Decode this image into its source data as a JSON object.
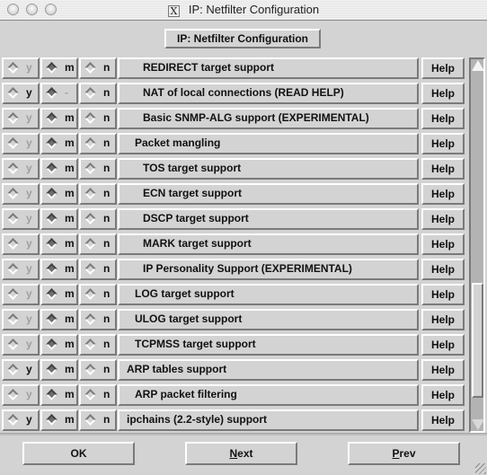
{
  "window": {
    "title": "IP: Netfilter Configuration",
    "title_icon": "x11-icon",
    "title_icon_glyph": "X"
  },
  "header": {
    "button_label": "IP: Netfilter Configuration"
  },
  "options": [
    {
      "label": "REDIRECT target support",
      "indent": 2,
      "y": {
        "label": "y",
        "enabled": false,
        "selected": false
      },
      "m": {
        "label": "m",
        "enabled": true,
        "selected": true
      },
      "n": {
        "label": "n",
        "enabled": true,
        "selected": false
      },
      "help": "Help"
    },
    {
      "label": "NAT of local connections (READ HELP)",
      "indent": 2,
      "y": {
        "label": "y",
        "enabled": true,
        "selected": false
      },
      "m": {
        "label": "-",
        "enabled": false,
        "selected": true
      },
      "n": {
        "label": "n",
        "enabled": true,
        "selected": false
      },
      "help": "Help"
    },
    {
      "label": "Basic SNMP-ALG support (EXPERIMENTAL)",
      "indent": 2,
      "y": {
        "label": "y",
        "enabled": false,
        "selected": false
      },
      "m": {
        "label": "m",
        "enabled": true,
        "selected": true
      },
      "n": {
        "label": "n",
        "enabled": true,
        "selected": false
      },
      "help": "Help"
    },
    {
      "label": "Packet mangling",
      "indent": 1,
      "y": {
        "label": "y",
        "enabled": false,
        "selected": false
      },
      "m": {
        "label": "m",
        "enabled": true,
        "selected": true
      },
      "n": {
        "label": "n",
        "enabled": true,
        "selected": false
      },
      "help": "Help"
    },
    {
      "label": "TOS target support",
      "indent": 2,
      "y": {
        "label": "y",
        "enabled": false,
        "selected": false
      },
      "m": {
        "label": "m",
        "enabled": true,
        "selected": true
      },
      "n": {
        "label": "n",
        "enabled": true,
        "selected": false
      },
      "help": "Help"
    },
    {
      "label": "ECN target support",
      "indent": 2,
      "y": {
        "label": "y",
        "enabled": false,
        "selected": false
      },
      "m": {
        "label": "m",
        "enabled": true,
        "selected": true
      },
      "n": {
        "label": "n",
        "enabled": true,
        "selected": false
      },
      "help": "Help"
    },
    {
      "label": "DSCP target support",
      "indent": 2,
      "y": {
        "label": "y",
        "enabled": false,
        "selected": false
      },
      "m": {
        "label": "m",
        "enabled": true,
        "selected": true
      },
      "n": {
        "label": "n",
        "enabled": true,
        "selected": false
      },
      "help": "Help"
    },
    {
      "label": "MARK target support",
      "indent": 2,
      "y": {
        "label": "y",
        "enabled": false,
        "selected": false
      },
      "m": {
        "label": "m",
        "enabled": true,
        "selected": true
      },
      "n": {
        "label": "n",
        "enabled": true,
        "selected": false
      },
      "help": "Help"
    },
    {
      "label": "IP Personality Support (EXPERIMENTAL)",
      "indent": 2,
      "y": {
        "label": "y",
        "enabled": false,
        "selected": false
      },
      "m": {
        "label": "m",
        "enabled": true,
        "selected": true
      },
      "n": {
        "label": "n",
        "enabled": true,
        "selected": false
      },
      "help": "Help"
    },
    {
      "label": "LOG target support",
      "indent": 1,
      "y": {
        "label": "y",
        "enabled": false,
        "selected": false
      },
      "m": {
        "label": "m",
        "enabled": true,
        "selected": true
      },
      "n": {
        "label": "n",
        "enabled": true,
        "selected": false
      },
      "help": "Help"
    },
    {
      "label": "ULOG target support",
      "indent": 1,
      "y": {
        "label": "y",
        "enabled": false,
        "selected": false
      },
      "m": {
        "label": "m",
        "enabled": true,
        "selected": true
      },
      "n": {
        "label": "n",
        "enabled": true,
        "selected": false
      },
      "help": "Help"
    },
    {
      "label": "TCPMSS target support",
      "indent": 1,
      "y": {
        "label": "y",
        "enabled": false,
        "selected": false
      },
      "m": {
        "label": "m",
        "enabled": true,
        "selected": true
      },
      "n": {
        "label": "n",
        "enabled": true,
        "selected": false
      },
      "help": "Help"
    },
    {
      "label": "ARP tables support",
      "indent": 0,
      "y": {
        "label": "y",
        "enabled": true,
        "selected": false
      },
      "m": {
        "label": "m",
        "enabled": true,
        "selected": true
      },
      "n": {
        "label": "n",
        "enabled": true,
        "selected": false
      },
      "help": "Help"
    },
    {
      "label": "ARP packet filtering",
      "indent": 1,
      "y": {
        "label": "y",
        "enabled": false,
        "selected": false
      },
      "m": {
        "label": "m",
        "enabled": true,
        "selected": true
      },
      "n": {
        "label": "n",
        "enabled": true,
        "selected": false
      },
      "help": "Help"
    },
    {
      "label": "ipchains (2.2-style) support",
      "indent": 0,
      "y": {
        "label": "y",
        "enabled": true,
        "selected": false
      },
      "m": {
        "label": "m",
        "enabled": true,
        "selected": true
      },
      "n": {
        "label": "n",
        "enabled": true,
        "selected": false
      },
      "help": "Help"
    }
  ],
  "scrollbar": {
    "thumb_start_fraction": 0.61,
    "thumb_end_fraction": 0.94
  },
  "footer": {
    "ok": {
      "label": "OK",
      "mnemonic": ""
    },
    "next": {
      "label": "Next",
      "mnemonic": "N"
    },
    "prev": {
      "label": "Prev",
      "mnemonic": "P"
    }
  }
}
